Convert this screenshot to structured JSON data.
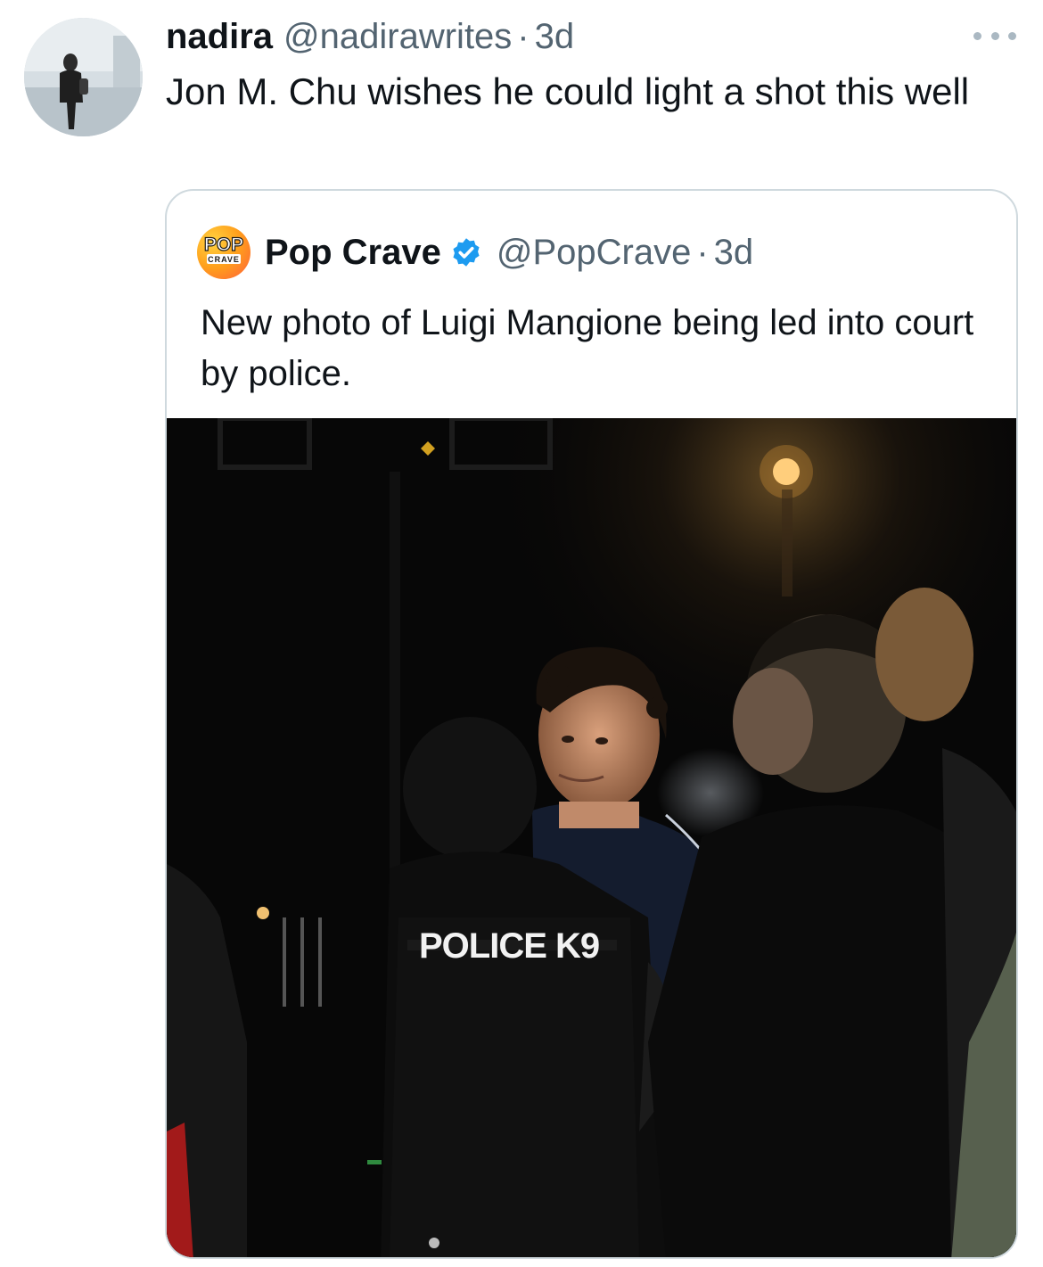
{
  "tweet": {
    "display_name": "nadira",
    "handle": "@nadirawrites",
    "separator": "·",
    "time": "3d",
    "text": "Jon M. Chu wishes he could light a shot this well",
    "more_icon": "more-dots-icon",
    "avatar_icon": "profile-avatar"
  },
  "quote": {
    "avatar_text_top": "POP",
    "avatar_text_bottom": "CRAVE",
    "display_name": "Pop Crave",
    "verified_icon": "verified-badge-icon",
    "handle": "@PopCrave",
    "separator": "·",
    "time": "3d",
    "text": "New photo of Luigi Mangione being led into court by police.",
    "photo": {
      "patch_text": "POLICE K9"
    }
  },
  "colors": {
    "text_primary": "#0f1419",
    "text_secondary": "#536471",
    "card_border": "#cfd9de",
    "verified_blue": "#1d9bf0",
    "dots": "#aab8c2"
  }
}
